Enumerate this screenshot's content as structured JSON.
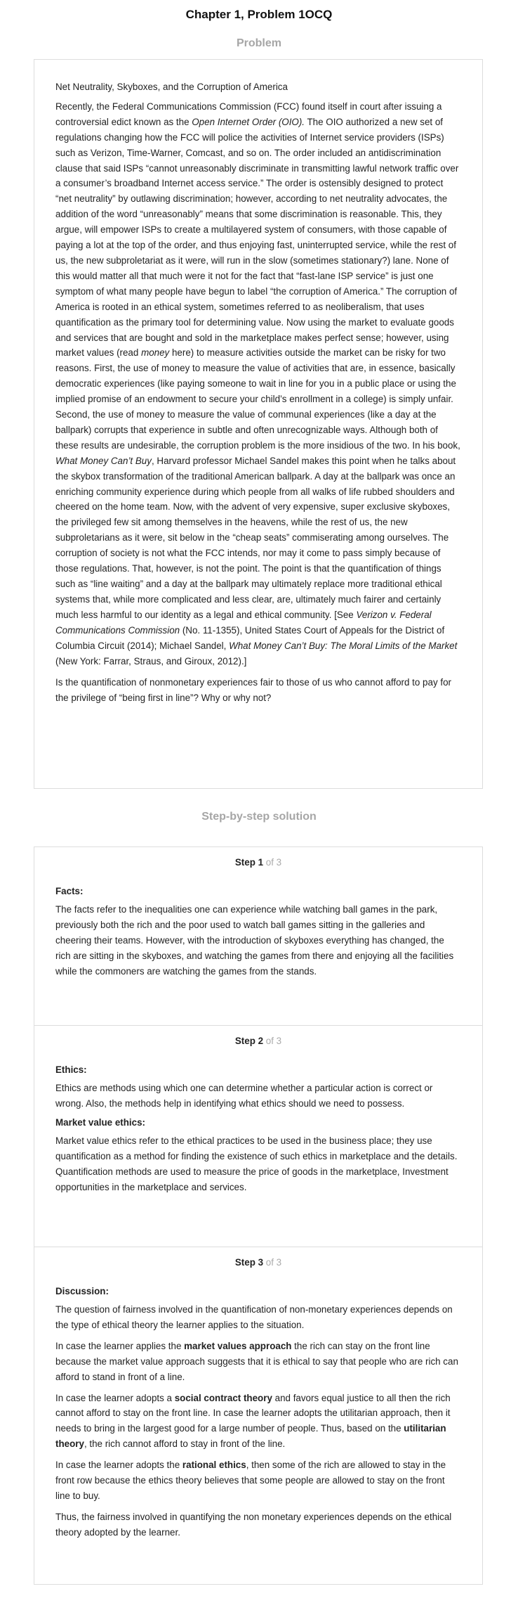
{
  "page": {
    "title": "Chapter 1, Problem 1OCQ",
    "problem_heading": "Problem",
    "solution_heading": "Step-by-step solution"
  },
  "problem": {
    "subject": "Net Neutrality, Skyboxes, and the Corruption of America",
    "p1": {
      "a": "Recently, the Federal Communications Commission (FCC) found itself in court after issuing a controversial edict known as the ",
      "b": "Open Internet Order (OIO).",
      "c": " The OIO authorized a new set of regulations changing how the FCC will police the activities of Internet service providers (ISPs) such as Verizon, Time-Warner, Comcast, and so on. The order included an antidiscrimination clause that said ISPs “cannot unreasonably discriminate in transmitting lawful network traffic over a consumer’s broadband Internet access service.” The order is ostensibly designed to protect “net neutrality” by outlawing discrimination; however, according to net neutrality advocates, the addition of the word “unreasonably” means that some discrimination is reasonable. This, they argue, will empower ISPs to create a multilayered system of consumers, with those capable of paying a lot at the top of the order, and thus enjoying fast, uninterrupted service, while the rest of us, the new subproletariat as it were, will run in the slow (sometimes stationary?) lane. None of this would matter all that much were it not for the fact that “fast-lane ISP service” is just one symptom of what many people have begun to label “the corruption of America.” The corruption of America is rooted in an ethical system, sometimes referred to as neoliberalism, that uses quantification as the primary tool for determining value. Now using the market to evaluate goods and services that are bought and sold in the marketplace makes perfect sense; however, using market values (read ",
      "d": "money",
      "e": " here) to measure activities outside the market can be risky for two reasons. First, the use of money to measure the value of activities that are, in essence, basically democratic experiences (like paying someone to wait in line for you in a public place or using the implied promise of an endowment to secure your child’s enrollment in a college) is simply unfair. Second, the use of money to measure the value of communal experiences (like a day at the ballpark) corrupts that experience in subtle and often unrecognizable ways. Although both of these results are undesirable, the corruption problem is the more insidious of the two. In his book, ",
      "f": "What Money Can’t Buy",
      "g": ", Harvard professor Michael Sandel makes this point when he talks about the skybox transformation of the traditional American ballpark. A day at the ballpark was once an enriching community experience during which people from all walks of life rubbed shoulders and cheered on the home team. Now, with the advent of very expensive, super exclusive skyboxes, the privileged few sit among themselves in the heavens, while the rest of us, the new subproletarians as it were, sit below in the “cheap seats” commiserating among ourselves. The corruption of society is not what the FCC intends, nor may it come to pass simply because of those regulations. That, however, is not the point. The point is that the quantification of things such as “line waiting” and a day at the ballpark may ultimately replace more traditional ethical systems that, while more complicated and less clear, are, ultimately much fairer and certainly much less harmful to our identity as a legal and ethical community. [See ",
      "h": "Verizon v. Federal Communications Commission",
      "i": " (No. 11-1355), United States Court of Appeals for the District of Columbia Circuit (2014); Michael Sandel, ",
      "j": "What Money Can’t Buy: The Moral Limits of the Market",
      "k": " (New York: Farrar, Straus, and Giroux, 2012).]"
    },
    "question": "Is the quantification of nonmonetary experiences fair to those of us who cannot afford to pay for the privilege of “being first in line”? Why or why not?"
  },
  "steps": {
    "of_label": "of 3",
    "step1": {
      "label": "Step 1",
      "heading": "Facts:",
      "text": "The facts refer to the inequalities one can experience while watching ball games in the park, previously both the rich and the poor used to watch ball games sitting in the galleries and cheering their teams. However, with the introduction of skyboxes everything has changed, the rich are sitting in the skyboxes, and watching the games from there and enjoying all the facilities while the commoners are watching the games from the stands."
    },
    "step2": {
      "label": "Step 2",
      "heading": "Ethics:",
      "text": "Ethics are methods using which one can determine whether a particular action is correct or wrong. Also, the methods help in identifying what ethics should we need to possess.",
      "heading2": "Market value ethics:",
      "text2": "Market value ethics refer to the ethical practices to be used in the business place; they use quantification as a method for finding the existence of such ethics in marketplace and the details. Quantification methods are used to measure the price of goods in the marketplace, Investment opportunities in the marketplace and services."
    },
    "step3": {
      "label": "Step 3",
      "heading": "Discussion:",
      "p1": "The question of fairness involved in the quantification of non-monetary experiences depends on the type of ethical theory the learner applies to the situation.",
      "p2": {
        "a": "In case the learner applies the ",
        "b": "market values approach",
        "c": " the rich can stay on the front line because the market value approach suggests that it is ethical to say that people who are rich can afford to stand in front of a line."
      },
      "p3": {
        "a": "In case the learner adopts a ",
        "b": "social contract theory",
        "c": " and favors equal justice to all then the rich cannot afford to stay on the front line. In case the learner adopts the utilitarian approach, then it needs to bring in the largest good for a large number of people. Thus, based on the ",
        "d": "utilitarian theory",
        "e": ", the rich cannot afford to stay in front of the line."
      },
      "p4": {
        "a": "In case the learner adopts the ",
        "b": "rational ethics",
        "c": ", then some of the rich are allowed to stay in the front row because the ethics theory believes that some people are allowed to stay on the front line to buy."
      },
      "p5": "Thus, the fairness involved in quantifying the non monetary experiences depends on the ethical theory adopted by the learner."
    }
  }
}
